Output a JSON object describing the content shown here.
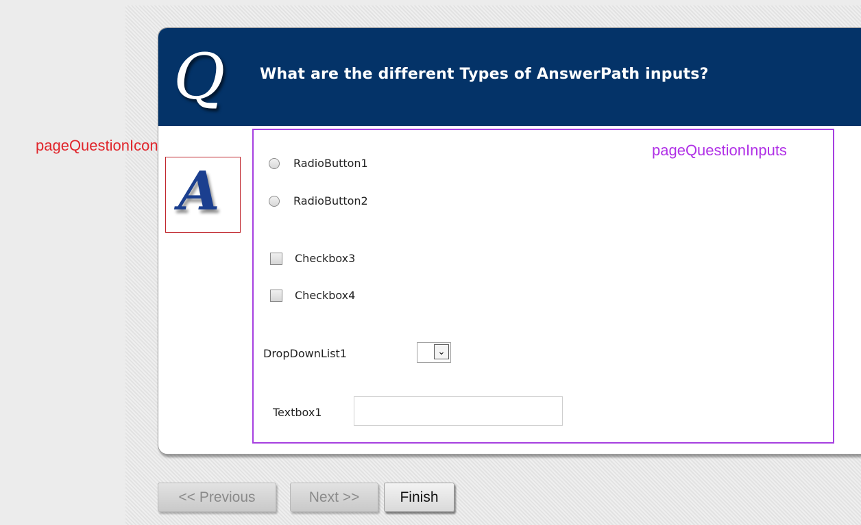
{
  "question": {
    "title": "What are the different Types of AnswerPath inputs?",
    "logo_letter": "Q"
  },
  "annotations": {
    "icon_label": "pageQuestionIcon",
    "inputs_label": "pageQuestionInputs"
  },
  "answer_icon": {
    "letter": "A"
  },
  "inputs": {
    "radios": [
      {
        "label": "RadioButton1",
        "checked": false
      },
      {
        "label": "RadioButton2",
        "checked": false
      }
    ],
    "checkboxes": [
      {
        "label": "Checkbox3",
        "checked": false
      },
      {
        "label": "Checkbox4",
        "checked": false
      }
    ],
    "dropdown": {
      "label": "DropDownList1",
      "value": ""
    },
    "textbox": {
      "label": "Textbox1",
      "value": ""
    }
  },
  "nav": {
    "previous": "<< Previous",
    "next": "Next >>",
    "finish": "Finish"
  },
  "colors": {
    "header_bg": "#043368",
    "icon_annotation": "#e0252b",
    "inputs_annotation": "#b030e6"
  }
}
